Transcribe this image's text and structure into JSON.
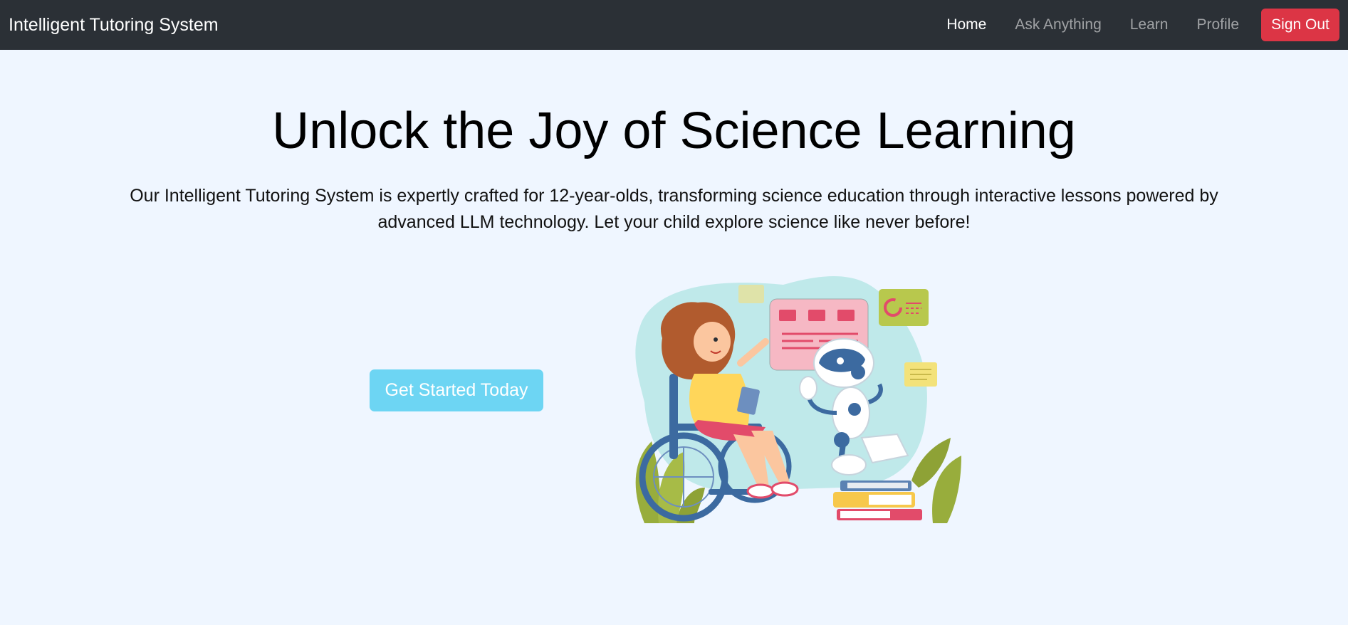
{
  "navbar": {
    "brand": "Intelligent Tutoring System",
    "links": [
      {
        "label": "Home",
        "active": true
      },
      {
        "label": "Ask Anything",
        "active": false
      },
      {
        "label": "Learn",
        "active": false
      },
      {
        "label": "Profile",
        "active": false
      }
    ],
    "sign_out_label": "Sign Out"
  },
  "hero": {
    "title": "Unlock the Joy of Science Learning",
    "description": "Our Intelligent Tutoring System is expertly crafted for 12-year-olds, transforming science education through interactive lessons powered by advanced LLM technology. Let your child explore science like never before!",
    "cta_label": "Get Started Today"
  },
  "colors": {
    "navbar_bg": "#2b3036",
    "page_bg": "#eff6ff",
    "sign_out_bg": "#dc3545",
    "cta_bg": "#6dd5f3"
  },
  "illustration": {
    "icon": "girl-wheelchair-robot-illustration"
  }
}
